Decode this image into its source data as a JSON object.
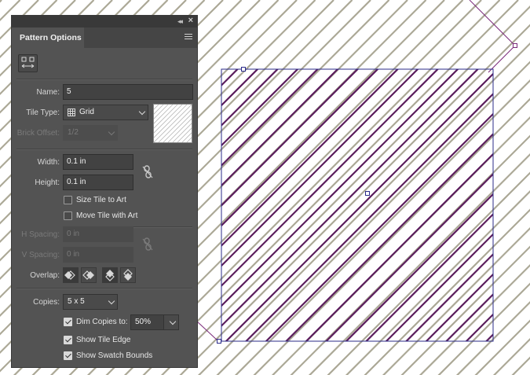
{
  "panel": {
    "title": "Pattern Options",
    "collapse_icon": "double-chevron-left-icon",
    "close_icon": "close-icon",
    "menu_icon": "hamburger-menu-icon",
    "name_label": "Name:",
    "name_value": "5",
    "tile_type_label": "Tile Type:",
    "tile_type_value": "Grid",
    "brick_offset_label": "Brick Offset:",
    "brick_offset_value": "1/2",
    "width_label": "Width:",
    "width_value": "0.1 in",
    "height_label": "Height:",
    "height_value": "0.1 in",
    "size_tile_to_art": {
      "label": "Size Tile to Art",
      "checked": false
    },
    "move_tile_with_art": {
      "label": "Move Tile with Art",
      "checked": false
    },
    "h_spacing_label": "H Spacing:",
    "h_spacing_value": "0 in",
    "v_spacing_label": "V Spacing:",
    "v_spacing_value": "0 in",
    "overlap_label": "Overlap:",
    "copies_label": "Copies:",
    "copies_value": "5 x 5",
    "dim_copies": {
      "label": "Dim Copies to:",
      "checked": true,
      "value": "50%"
    },
    "show_tile_edge": {
      "label": "Show Tile Edge",
      "checked": true
    },
    "show_swatch_bounds": {
      "label": "Show Swatch Bounds",
      "checked": true
    }
  },
  "colors": {
    "panel_bg": "#535353",
    "stripe_primary": "#5a1c5c",
    "stripe_dim": "#aba896",
    "tile_edge": "#2b2b8a",
    "swatch_bounds": "#7a2a7a"
  }
}
